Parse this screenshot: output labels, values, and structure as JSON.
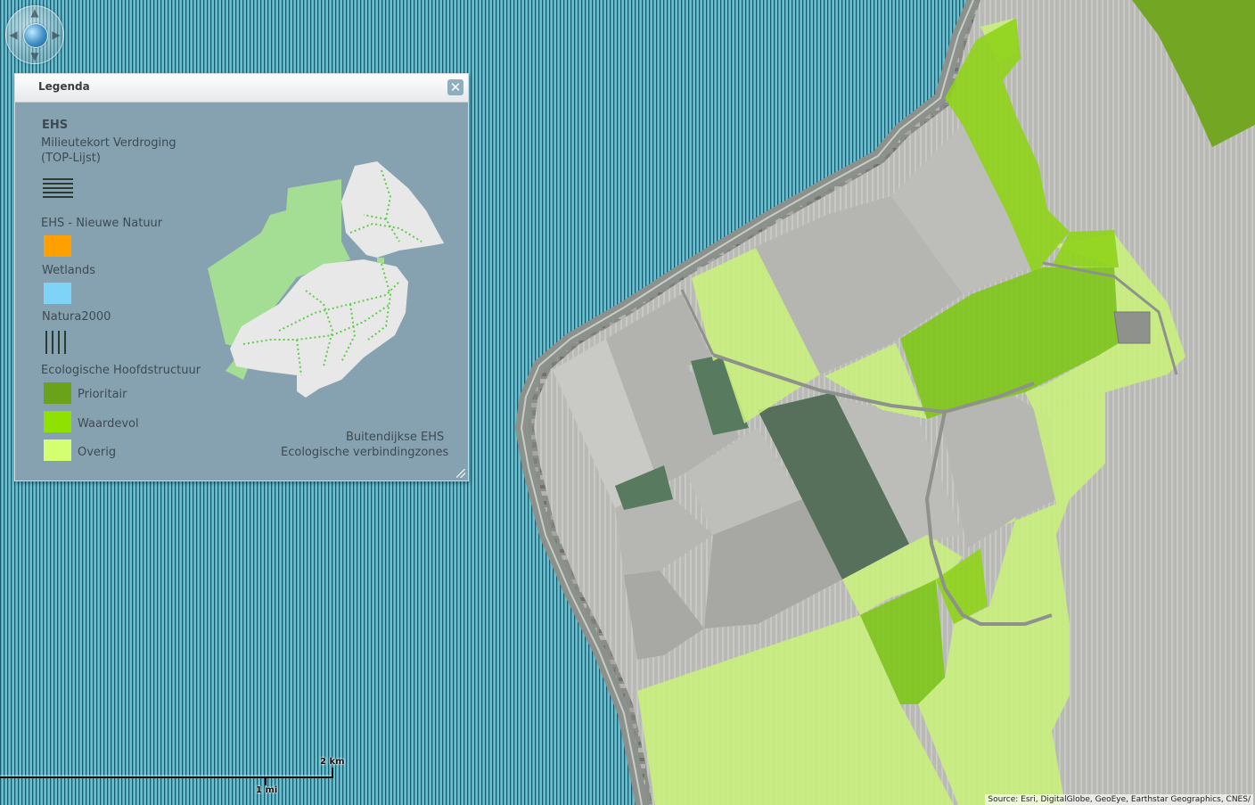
{
  "map": {
    "colors": {
      "water": "#63c1d2",
      "water_hatch": "#1c5a6e",
      "land": "#9a9b96",
      "prioritair": "#6fa41a",
      "waardevol": "#8fd318",
      "overig": "#caf27a",
      "dyke": "#8d918c"
    }
  },
  "legend": {
    "title": "Legenda",
    "close_symbol": "✕",
    "section_ehs": "EHS",
    "milieutekort_line1": "Milieutekort Verdroging",
    "milieutekort_line2": "(TOP-Lijst)",
    "nieuwe_natuur": "EHS - Nieuwe Natuur",
    "wetlands": "Wetlands",
    "natura2000": "Natura2000",
    "ecologische_hoofdstructuur": "Ecologische Hoofdstructuur",
    "prioritair": "Prioritair",
    "waardevol": "Waardevol",
    "overig": "Overig",
    "buitendijkse": "Buitendijkse EHS",
    "verbindingszones": "Ecologische verbindingzones",
    "colors": {
      "nieuwe_natuur": "#ff9f00",
      "wetlands": "#7fd3f7",
      "prioritair": "#6aa21a",
      "waardevol": "#8ee100",
      "overig": "#d3ff70",
      "hatch": "#2b3a33",
      "inset_green": "#a4dd94",
      "inset_land": "#e8e8e8",
      "inset_dots": "#5fcd49"
    }
  },
  "scale": {
    "km_label": "2 km",
    "mi_label": "1 mi"
  },
  "attribution": "Source: Esri, DigitalGlobe, GeoEye, Earthstar Geographics, CNES/"
}
